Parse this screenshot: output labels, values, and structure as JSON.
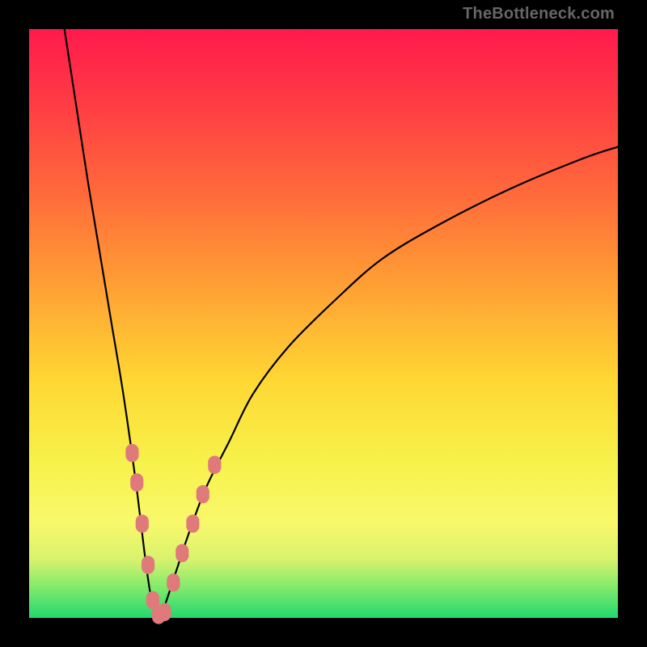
{
  "watermark": "TheBottleneck.com",
  "chart_data": {
    "type": "line",
    "title": "",
    "xlabel": "",
    "ylabel": "",
    "xlim": [
      0,
      100
    ],
    "ylim": [
      0,
      100
    ],
    "grid": false,
    "legend": false,
    "series": [
      {
        "name": "curve",
        "color": "#000000",
        "x": [
          6,
          8,
          10,
          12,
          14,
          16,
          18,
          19,
          20,
          21,
          22,
          23,
          25,
          27,
          30,
          34,
          38,
          44,
          52,
          60,
          70,
          82,
          94,
          100
        ],
        "y": [
          100,
          87,
          74,
          62,
          50,
          38,
          24,
          16,
          8,
          2,
          0,
          2,
          8,
          14,
          22,
          30,
          38,
          46,
          54,
          61,
          67,
          73,
          78,
          80
        ]
      }
    ],
    "markers": {
      "name": "highlight-dots",
      "color": "#e07a7a",
      "radius_px": 9,
      "points": [
        {
          "x": 17.5,
          "y": 28
        },
        {
          "x": 18.3,
          "y": 23
        },
        {
          "x": 19.2,
          "y": 16
        },
        {
          "x": 20.2,
          "y": 9
        },
        {
          "x": 21.0,
          "y": 3
        },
        {
          "x": 22.0,
          "y": 0.5
        },
        {
          "x": 23.0,
          "y": 1
        },
        {
          "x": 24.5,
          "y": 6
        },
        {
          "x": 26.0,
          "y": 11
        },
        {
          "x": 27.8,
          "y": 16
        },
        {
          "x": 29.5,
          "y": 21
        },
        {
          "x": 31.5,
          "y": 26
        }
      ]
    }
  }
}
